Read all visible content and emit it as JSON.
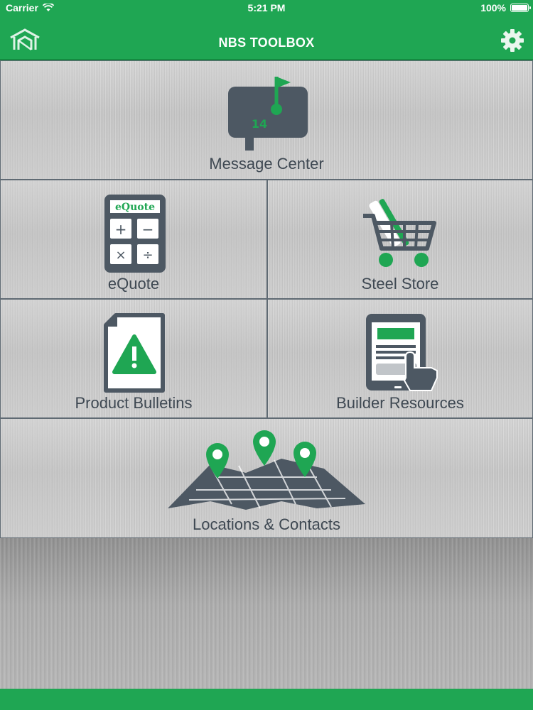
{
  "status_bar": {
    "carrier": "Carrier",
    "time": "5:21 PM",
    "battery": "100%"
  },
  "nav": {
    "title": "NBS TOOLBOX",
    "home_icon": "building-icon",
    "settings_icon": "gear-icon"
  },
  "tiles": {
    "message_center": {
      "label": "Message Center",
      "badge": "14",
      "icon": "mailbox-icon"
    },
    "equote": {
      "label": "eQuote",
      "icon_text": "eQuote",
      "icon": "calculator-icon"
    },
    "steel_store": {
      "label": "Steel Store",
      "icon": "shopping-cart-icon"
    },
    "product_bulletins": {
      "label": "Product Bulletins",
      "icon": "warning-document-icon"
    },
    "builder_resources": {
      "label": "Builder Resources",
      "icon": "tablet-touch-icon"
    },
    "locations_contacts": {
      "label": "Locations & Contacts",
      "icon": "map-pins-icon"
    }
  },
  "colors": {
    "brand_green": "#1fa653",
    "icon_gray": "#4d5863",
    "label_gray": "#3e4852"
  }
}
